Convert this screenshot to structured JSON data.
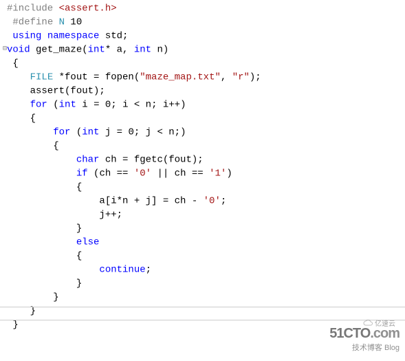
{
  "gutter": {
    "collapse": "⊟"
  },
  "code": {
    "l1": {
      "a": "#include",
      "b": " ",
      "c": "<assert.h>"
    },
    "l2": {
      "a": "#define",
      "b": " ",
      "c": "N",
      "d": " 10"
    },
    "l3": {
      "a": "using",
      "b": " ",
      "c": "namespace",
      "d": " std;"
    },
    "l4": {
      "a": "void",
      "b": " get_maze(",
      "c": "int",
      "d": "* a, ",
      "e": "int",
      "f": " n)"
    },
    "l5": {
      "a": "{"
    },
    "l6": {
      "a": "    ",
      "b": "FILE",
      "c": " *fout = fopen(",
      "d": "\"maze_map.txt\"",
      "e": ", ",
      "f": "\"r\"",
      "g": ");"
    },
    "l7": {
      "a": "    assert(fout);"
    },
    "l8": {
      "a": "    ",
      "b": "for",
      "c": " (",
      "d": "int",
      "e": " i = 0; i < n; i++)"
    },
    "l9": {
      "a": "    {"
    },
    "l10": {
      "a": "        ",
      "b": "for",
      "c": " (",
      "d": "int",
      "e": " j = 0; j < n;)"
    },
    "l11": {
      "a": "        {"
    },
    "l12": {
      "a": "            ",
      "b": "char",
      "c": " ch = fgetc(fout);"
    },
    "l13": {
      "a": "            ",
      "b": "if",
      "c": " (ch == ",
      "d": "'0'",
      "e": " || ch == ",
      "f": "'1'",
      "g": ")"
    },
    "l14": {
      "a": "            {"
    },
    "l15": {
      "a": "                a[i*n + j] = ch - ",
      "b": "'0'",
      "c": ";"
    },
    "l16": {
      "a": "                j++;"
    },
    "l17": {
      "a": "            }"
    },
    "l18": {
      "a": "            ",
      "b": "else"
    },
    "l19": {
      "a": "            {"
    },
    "l20": {
      "a": "                ",
      "b": "continue",
      "c": ";"
    },
    "l21": {
      "a": "            }"
    },
    "l22": {
      "a": "        }"
    },
    "l23": {
      "a": "    }"
    },
    "l24": {
      "a": "}"
    }
  },
  "watermark": {
    "site1a": "51CTO",
    "site1b": ".com",
    "site2": "技术博客   Blog",
    "site3": "亿速云"
  }
}
